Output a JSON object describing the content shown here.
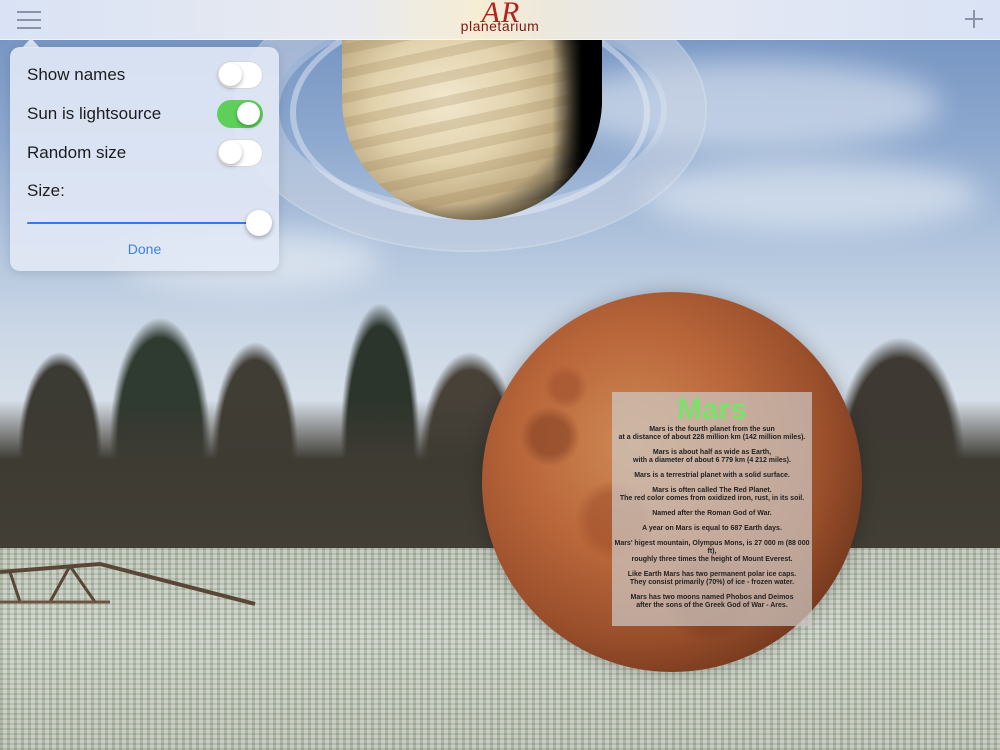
{
  "app": {
    "logo_main": "AR",
    "logo_sub": "planetarium"
  },
  "icons": {
    "menu": "hamburger-menu-icon",
    "add": "plus-icon"
  },
  "settings": {
    "show_names": {
      "label": "Show names",
      "on": false
    },
    "sun_lightsource": {
      "label": "Sun is lightsource",
      "on": true
    },
    "random_size": {
      "label": "Random size",
      "on": false
    },
    "size": {
      "label": "Size:",
      "value": 1.0
    },
    "done_label": "Done"
  },
  "colors": {
    "toggle_on": "#5dd05a",
    "slider_fill": "#3478f6",
    "done": "#3b82e6",
    "info_title": "#7be06c",
    "logo": "#b3221c"
  },
  "planet_info": {
    "title": "Mars",
    "paragraphs": [
      [
        "Mars is the fourth planet from the sun",
        "at a distance of about 228 million km (142 million miles)."
      ],
      [
        "Mars is about half as wide as Earth,",
        "with a diameter of about 6 779 km (4 212 miles)."
      ],
      [
        "Mars is a terrestrial planet with a solid surface."
      ],
      [
        "Mars is often called The Red Planet.",
        "The red color comes from oxidized iron, rust, in its soil."
      ],
      [
        "Named after the Roman God of War."
      ],
      [
        "A year on Mars is equal to 687 Earth days."
      ],
      [
        "Mars' higest mountain, Olympus Mons, is 27 000 m (88 000 ft),",
        "roughly three times the height of Mount Everest."
      ],
      [
        "Like Earth Mars has two permanent polar ice caps.",
        "They consist primarily (70%) of ice - frozen water."
      ],
      [
        "Mars has two moons named Phobos and Deimos",
        "after the sons of the Greek God of War - Ares."
      ]
    ]
  }
}
